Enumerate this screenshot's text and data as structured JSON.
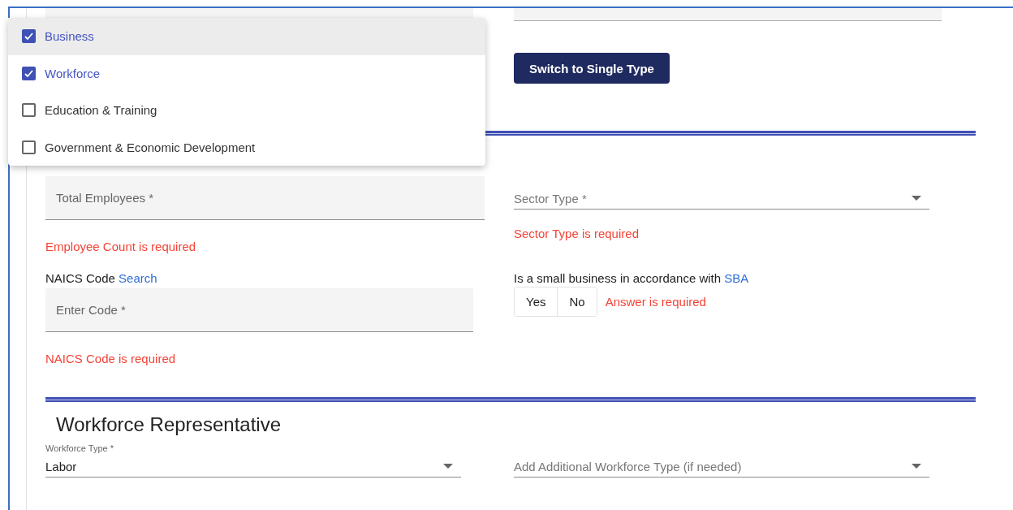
{
  "switch_button": "Switch to Single Type",
  "category_menu": {
    "items": [
      {
        "label": "Business",
        "checked": true,
        "highlighted": true
      },
      {
        "label": "Workforce",
        "checked": true,
        "highlighted": false
      },
      {
        "label": "Education & Training",
        "checked": false,
        "highlighted": false
      },
      {
        "label": "Government & Economic Development",
        "checked": false,
        "highlighted": false
      }
    ]
  },
  "organization": {
    "total_employees": {
      "placeholder": "Total Employees *",
      "error": "Employee Count is required"
    },
    "sector_type": {
      "placeholder": "Sector Type *",
      "error": "Sector Type is required"
    },
    "naics": {
      "label": "NAICS Code",
      "link": "Search",
      "placeholder": "Enter Code *",
      "error": "NAICS Code is required"
    },
    "small_business": {
      "label": "Is a small business in accordance with",
      "link": "SBA",
      "options": [
        {
          "label": "Yes",
          "selected": false
        },
        {
          "label": "No",
          "selected": false
        }
      ],
      "error": "Answer is required"
    }
  },
  "workforce_representative": {
    "heading": "Workforce Representative",
    "workforce_type": {
      "label": "Workforce Type *",
      "value": "Labor"
    },
    "additional_type": {
      "placeholder": "Add Additional Workforce Type (if needed)"
    }
  }
}
